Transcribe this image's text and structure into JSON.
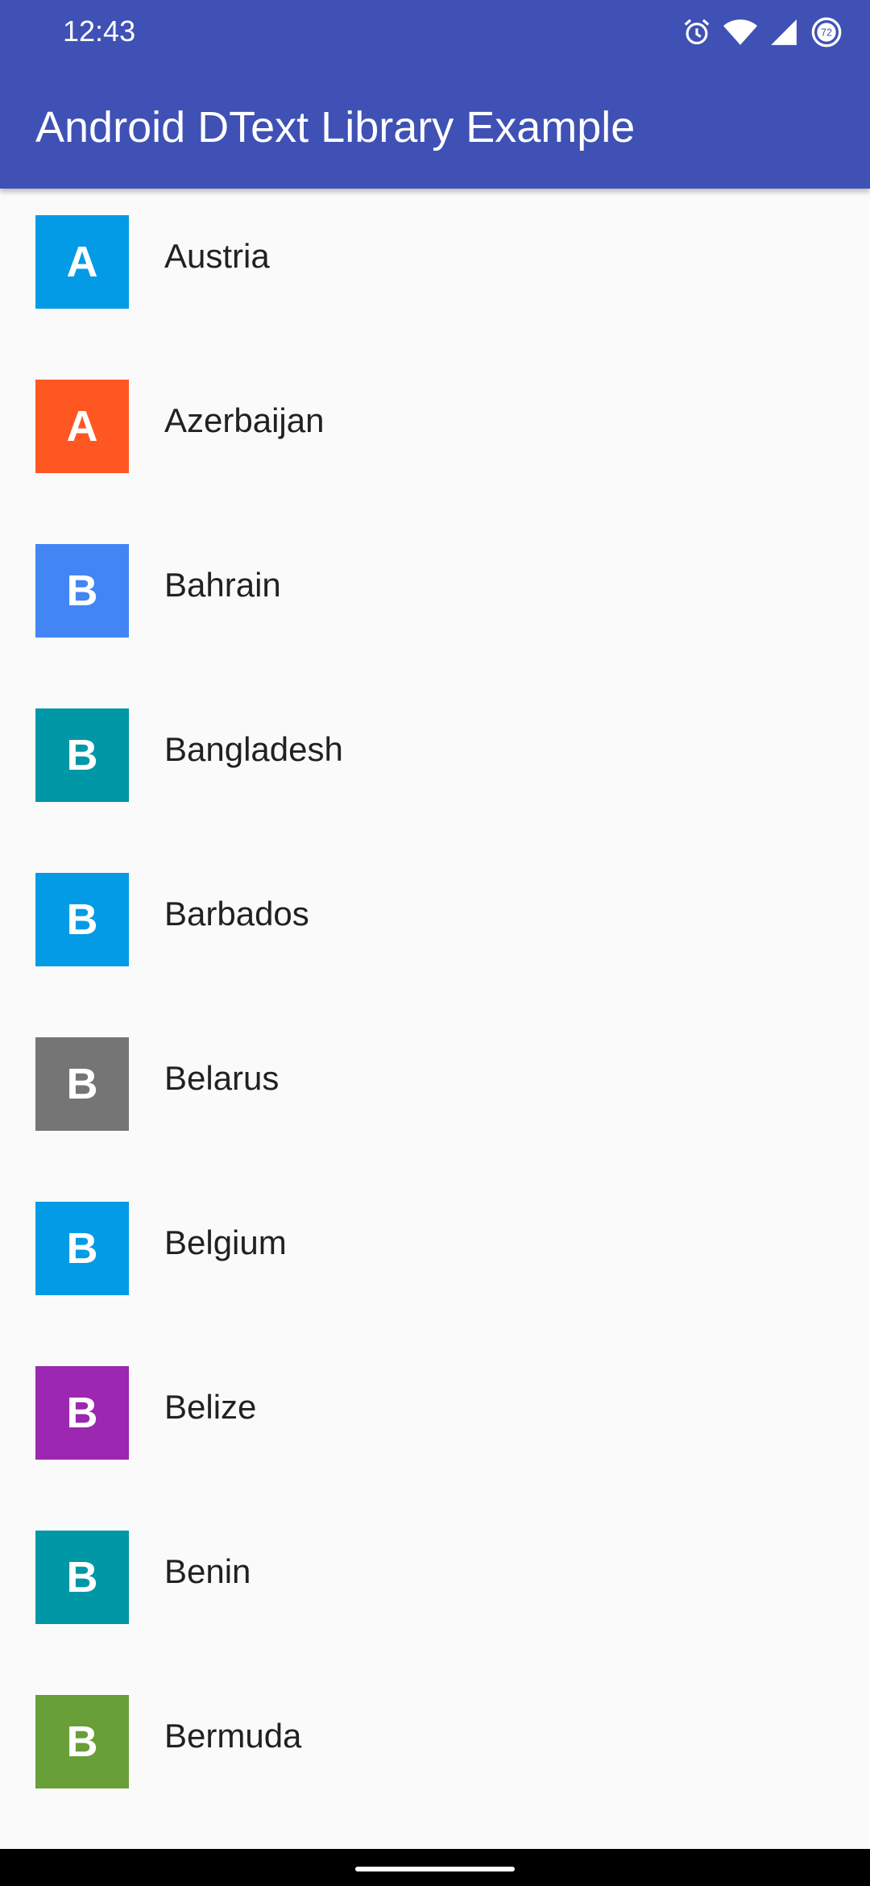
{
  "status_bar": {
    "time": "12:43",
    "battery_level": "72",
    "icons": [
      "alarm-icon",
      "wifi-icon",
      "signal-icon",
      "battery-icon"
    ]
  },
  "app_bar": {
    "title": "Android DText Library Example",
    "color": "#3f51b5"
  },
  "countries": [
    {
      "letter": "A",
      "name": "Austria",
      "color": "#039be5"
    },
    {
      "letter": "A",
      "name": "Azerbaijan",
      "color": "#ff5722"
    },
    {
      "letter": "B",
      "name": "Bahrain",
      "color": "#4285f4"
    },
    {
      "letter": "B",
      "name": "Bangladesh",
      "color": "#0097a7"
    },
    {
      "letter": "B",
      "name": "Barbados",
      "color": "#039be5"
    },
    {
      "letter": "B",
      "name": "Belarus",
      "color": "#757575"
    },
    {
      "letter": "B",
      "name": "Belgium",
      "color": "#039be5"
    },
    {
      "letter": "B",
      "name": "Belize",
      "color": "#9c27b0"
    },
    {
      "letter": "B",
      "name": "Benin",
      "color": "#0097a7"
    },
    {
      "letter": "B",
      "name": "Bermuda",
      "color": "#689f38"
    }
  ]
}
